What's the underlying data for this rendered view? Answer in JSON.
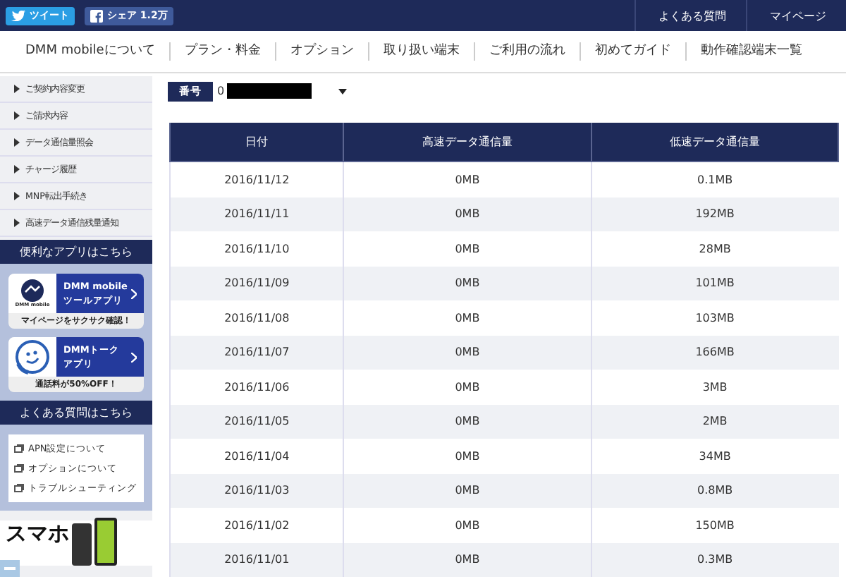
{
  "top_bar": {
    "share_buttons": [
      {
        "kind": "twitter",
        "label": "ツイート"
      },
      {
        "kind": "facebook",
        "label": "シェア 1.2万"
      }
    ],
    "links": [
      "よくある質問",
      "マイページ"
    ]
  },
  "nav": [
    "DMM mobileについて",
    "プラン・料金",
    "オプション",
    "取り扱い端末",
    "ご利用の流れ",
    "初めてガイド",
    "動作確認端末一覧"
  ],
  "sidebar": {
    "items": [
      "ご契約内容変更",
      "ご請求内容",
      "データ通信量照会",
      "チャージ履歴",
      "MNP転出手続き",
      "高速データ通信残量通知"
    ],
    "apps_heading": "便利なアプリはこちら",
    "apps": [
      {
        "kind": "tool",
        "title_lines": [
          "DMM mobile",
          "ツールアプリ"
        ],
        "icon_caption": "DMM mobile",
        "caption": "マイページをサクサク確認！"
      },
      {
        "kind": "talk",
        "title_lines": [
          "DMMトーク",
          "アプリ"
        ],
        "caption": "通話料が50%OFF！"
      }
    ],
    "faq_heading": "よくある質問はこちら",
    "faq_links": [
      "APN設定について",
      "オプションについて",
      "トラブルシューティング"
    ],
    "banner": {
      "text": "スマホ"
    }
  },
  "number_field": {
    "label": "番号",
    "value": "0"
  },
  "table": {
    "columns": [
      "日付",
      "高速データ通信量",
      "低速データ通信量"
    ],
    "rows": [
      [
        "2016/11/12",
        "0MB",
        "0.1MB"
      ],
      [
        "2016/11/11",
        "0MB",
        "192MB"
      ],
      [
        "2016/11/10",
        "0MB",
        "28MB"
      ],
      [
        "2016/11/09",
        "0MB",
        "101MB"
      ],
      [
        "2016/11/08",
        "0MB",
        "103MB"
      ],
      [
        "2016/11/07",
        "0MB",
        "166MB"
      ],
      [
        "2016/11/06",
        "0MB",
        "3MB"
      ],
      [
        "2016/11/05",
        "0MB",
        "2MB"
      ],
      [
        "2016/11/04",
        "0MB",
        "34MB"
      ],
      [
        "2016/11/03",
        "0MB",
        "0.8MB"
      ],
      [
        "2016/11/02",
        "0MB",
        "150MB"
      ],
      [
        "2016/11/01",
        "0MB",
        "0.3MB"
      ]
    ]
  }
}
